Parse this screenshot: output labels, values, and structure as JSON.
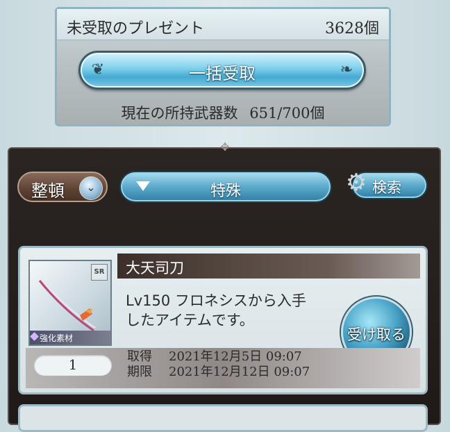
{
  "summary": {
    "title": "未受取のプレゼント",
    "count": "3628個",
    "bulk_receive_label": "一括受取",
    "owned_label": "現在の所持武器数",
    "owned_value": "651/700個"
  },
  "toolbar": {
    "sort_label": "整頓",
    "filter_label": "特殊",
    "search_label": "検索"
  },
  "items": [
    {
      "name": "大天司刀",
      "rarity": "SR",
      "tag": "強化素材",
      "description_line1": "Lv150 フロネシスから入手",
      "description_line2": "したアイテムです。",
      "receive_label": "受け取る",
      "quantity": "1",
      "acquired_label": "取得",
      "acquired_value": "2021年12月5日 09:07",
      "expires_label": "期限",
      "expires_value": "2021年12月12日 09:07"
    }
  ]
}
